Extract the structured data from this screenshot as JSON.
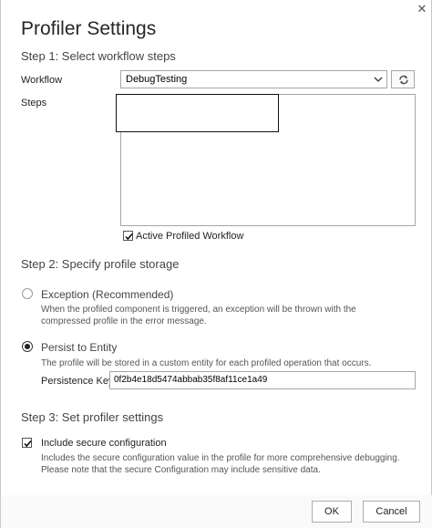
{
  "dialog": {
    "title": "Profiler Settings",
    "close_glyph": "✕"
  },
  "step1": {
    "heading": "Step 1: Select workflow steps",
    "workflow_label": "Workflow",
    "workflow_value": "DebugTesting",
    "steps_label": "Steps",
    "active_profiled_label": "Active Profiled Workflow",
    "active_profiled_checked": true
  },
  "step2": {
    "heading": "Step 2: Specify profile storage",
    "exception_label": "Exception (Recommended)",
    "exception_desc": "When the profiled component is triggered, an exception will be thrown with the compressed profile in the error message.",
    "exception_selected": false,
    "persist_label": "Persist to Entity",
    "persist_desc": "The profile will be stored in a custom entity for each profiled operation that occurs.",
    "persist_selected": true,
    "persistence_key_label": "Persistence Key",
    "persistence_key_value": "0f2b4e18d5474abbab35f8af11ce1a49"
  },
  "step3": {
    "heading": "Step 3: Set profiler settings",
    "secure_label": "Include secure configuration",
    "secure_checked": true,
    "secure_desc": "Includes the secure configuration value in the profile for more comprehensive debugging. Please note that the secure Configuration may include sensitive data."
  },
  "footer": {
    "ok_label": "OK",
    "cancel_label": "Cancel"
  },
  "icons": {
    "dropdown": "chevron-down-icon",
    "refresh": "refresh-icon",
    "check": "checkmark-icon",
    "close": "close-icon"
  }
}
